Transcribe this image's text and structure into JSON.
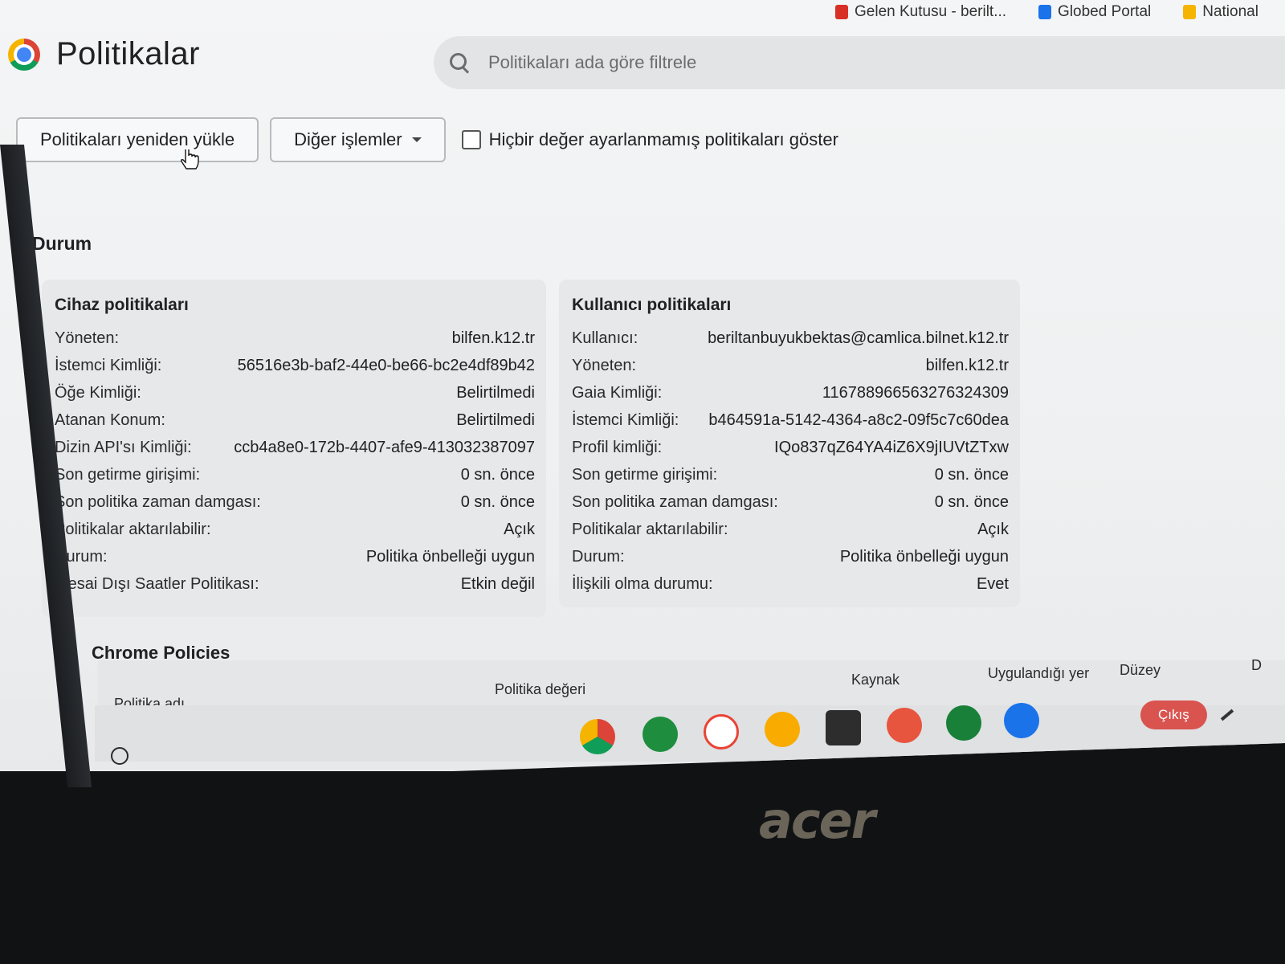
{
  "bookmarks": [
    {
      "label": "Gelen Kutusu - berilt...",
      "icon": "gmail-icon",
      "color": "#d93025"
    },
    {
      "label": "Globed Portal",
      "icon": "globed-icon",
      "color": "#1a73e8"
    },
    {
      "label": "National",
      "icon": "bookmark-icon",
      "color": "#f4b400"
    }
  ],
  "header": {
    "title": "Politikalar",
    "search_placeholder": "Politikaları ada göre filtrele"
  },
  "toolbar": {
    "reload_label": "Politikaları yeniden yükle",
    "more_actions_label": "Diğer işlemler",
    "show_unset_label": "Hiçbir değer ayarlanmamış politikaları göster",
    "show_unset_checked": false
  },
  "status": {
    "title": "Durum",
    "device": {
      "title": "Cihaz politikaları",
      "rows": [
        {
          "label": "Yöneten:",
          "value": "bilfen.k12.tr"
        },
        {
          "label": "İstemci Kimliği:",
          "value": "56516e3b-baf2-44e0-be66-bc2e4df89b42"
        },
        {
          "label": "Öğe Kimliği:",
          "value": "Belirtilmedi"
        },
        {
          "label": "Atanan Konum:",
          "value": "Belirtilmedi"
        },
        {
          "label": "Dizin API'sı Kimliği:",
          "value": "ccb4a8e0-172b-4407-afe9-413032387097"
        },
        {
          "label": "Son getirme girişimi:",
          "value": "0 sn. önce"
        },
        {
          "label": "Son politika zaman damgası:",
          "value": "0 sn. önce"
        },
        {
          "label": "Politikalar aktarılabilir:",
          "value": "Açık"
        },
        {
          "label": "Durum:",
          "value": "Politika önbelleği uygun"
        },
        {
          "label": "Mesai Dışı Saatler Politikası:",
          "value": "Etkin değil"
        }
      ]
    },
    "user": {
      "title": "Kullanıcı politikaları",
      "rows": [
        {
          "label": "Kullanıcı:",
          "value": "beriltanbuyukbektas@camlica.bilnet.k12.tr"
        },
        {
          "label": "Yöneten:",
          "value": "bilfen.k12.tr"
        },
        {
          "label": "Gaia Kimliği:",
          "value": "116788966563276324309"
        },
        {
          "label": "İstemci Kimliği:",
          "value": "b464591a-5142-4364-a8c2-09f5c7c60dea"
        },
        {
          "label": "Profil kimliği:",
          "value": "IQo837qZ64YA4iZ6X9jIUVtZTxw"
        },
        {
          "label": "Son getirme girişimi:",
          "value": "0 sn. önce"
        },
        {
          "label": "Son politika zaman damgası:",
          "value": "0 sn. önce"
        },
        {
          "label": "Politikalar aktarılabilir:",
          "value": "Açık"
        },
        {
          "label": "Durum:",
          "value": "Politika önbelleği uygun"
        },
        {
          "label": "İlişkili olma durumu:",
          "value": "Evet"
        }
      ]
    }
  },
  "chrome_policies": {
    "title": "Chrome Policies",
    "columns": [
      "Politika adı",
      "Politika değeri",
      "Kaynak",
      "Uygulandığı yer",
      "Düzey",
      "D"
    ]
  },
  "shelf": {
    "apps": [
      {
        "name": "chrome-app-icon",
        "color": "#4285f4"
      },
      {
        "name": "calculator-app-icon",
        "color": "#1e8e3e"
      },
      {
        "name": "gmail-app-icon",
        "color": "#ea4335"
      },
      {
        "name": "music-app-icon",
        "color": "#f9ab00"
      },
      {
        "name": "terminal-app-icon",
        "color": "#2d2d2d"
      },
      {
        "name": "paint-app-icon",
        "color": "#e8553e"
      },
      {
        "name": "classroom-app-icon",
        "color": "#188038"
      },
      {
        "name": "files-app-icon",
        "color": "#1a73e8"
      }
    ],
    "logout_label": "Çıkış"
  },
  "hardware": {
    "brand": "acer"
  }
}
